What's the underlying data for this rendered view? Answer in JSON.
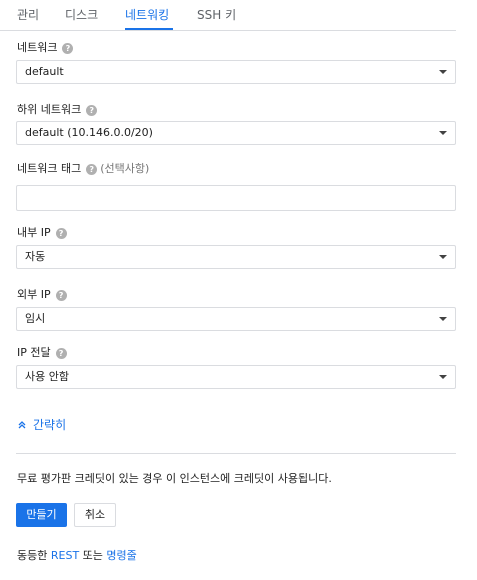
{
  "tabs": {
    "management": "관리",
    "disks": "디스크",
    "networking": "네트워킹",
    "ssh_keys": "SSH 키",
    "active": "networking"
  },
  "help_glyph": "?",
  "fields": {
    "network": {
      "label": "네트워크",
      "value": "default"
    },
    "subnetwork": {
      "label": "하위 네트워크",
      "value": "default (10.146.0.0/20)"
    },
    "network_tags": {
      "label": "네트워크 태그",
      "optional": "(선택사항)",
      "value": ""
    },
    "internal_ip": {
      "label": "내부 IP",
      "value": "자동"
    },
    "external_ip": {
      "label": "외부 IP",
      "value": "임시"
    },
    "ip_forwarding": {
      "label": "IP 전달",
      "value": "사용 안함"
    }
  },
  "collapse": {
    "label": "간략히",
    "icon": "chevron-up-icon"
  },
  "info": "무료 평가판 크레딧이 있는 경우 이 인스턴스에 크레딧이 사용됩니다.",
  "buttons": {
    "create": "만들기",
    "cancel": "취소"
  },
  "footer": {
    "prefix": "동등한",
    "rest": "REST",
    "middle": "또는",
    "command_line": "명령줄"
  },
  "colors": {
    "accent": "#1a73e8",
    "border": "#dadce0",
    "text": "#212121",
    "muted": "#5f6368"
  }
}
